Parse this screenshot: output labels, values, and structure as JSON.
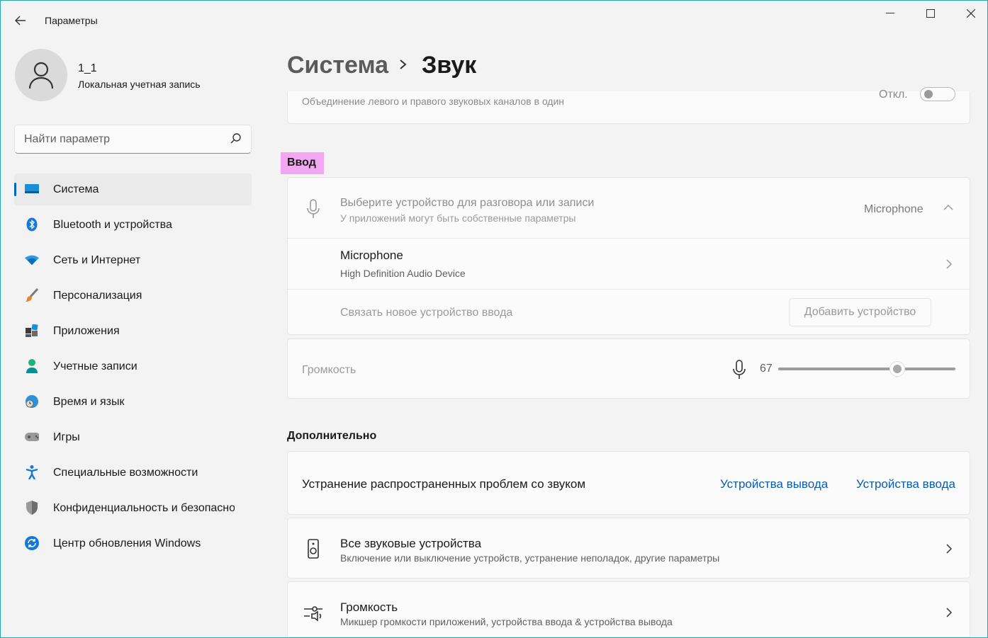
{
  "window": {
    "title": "Параметры"
  },
  "user": {
    "name": "1_1",
    "account_type": "Локальная учетная запись"
  },
  "search": {
    "placeholder": "Найти параметр"
  },
  "sidebar": {
    "items": [
      {
        "label": "Система",
        "icon": "system-icon",
        "active": true
      },
      {
        "label": "Bluetooth и устройства",
        "icon": "bluetooth-icon"
      },
      {
        "label": "Сеть и Интернет",
        "icon": "wifi-icon"
      },
      {
        "label": "Персонализация",
        "icon": "brush-icon"
      },
      {
        "label": "Приложения",
        "icon": "apps-icon"
      },
      {
        "label": "Учетные записи",
        "icon": "person-icon"
      },
      {
        "label": "Время и язык",
        "icon": "globe-clock-icon"
      },
      {
        "label": "Игры",
        "icon": "gamepad-icon"
      },
      {
        "label": "Специальные возможности",
        "icon": "accessibility-icon"
      },
      {
        "label": "Конфиденциальность и безопасность",
        "icon": "shield-icon"
      },
      {
        "label": "Центр обновления Windows",
        "icon": "update-icon"
      }
    ]
  },
  "breadcrumb": {
    "parent": "Система",
    "current": "Звук"
  },
  "mono_audio": {
    "description": "Объединение левого и правого звуковых каналов в один",
    "state": "Откл."
  },
  "input": {
    "section_label": "Ввод",
    "choose_title": "Выберите устройство для разговора или записи",
    "choose_subtitle": "У приложений могут быть собственные параметры",
    "selected_device": "Microphone",
    "device_name": "Microphone",
    "device_desc": "High Definition Audio Device",
    "pair_text": "Связать новое устройство ввода",
    "add_button": "Добавить устройство",
    "volume_label": "Громкость",
    "volume_value": "67"
  },
  "advanced": {
    "section_label": "Дополнительно",
    "troubleshoot_text": "Устранение распространенных проблем со звуком",
    "link_output": "Устройства вывода",
    "link_input": "Устройства ввода",
    "all_devices_title": "Все звуковые устройства",
    "all_devices_sub": "Включение или выключение устройств, устранение неполадок, другие параметры",
    "mixer_title": "Громкость",
    "mixer_sub": "Микшер громкости приложений, устройства ввода & устройства вывода"
  },
  "colors": {
    "accent": "#0067c0",
    "link": "#0a5cb0",
    "highlight": "#f3a7f0"
  }
}
